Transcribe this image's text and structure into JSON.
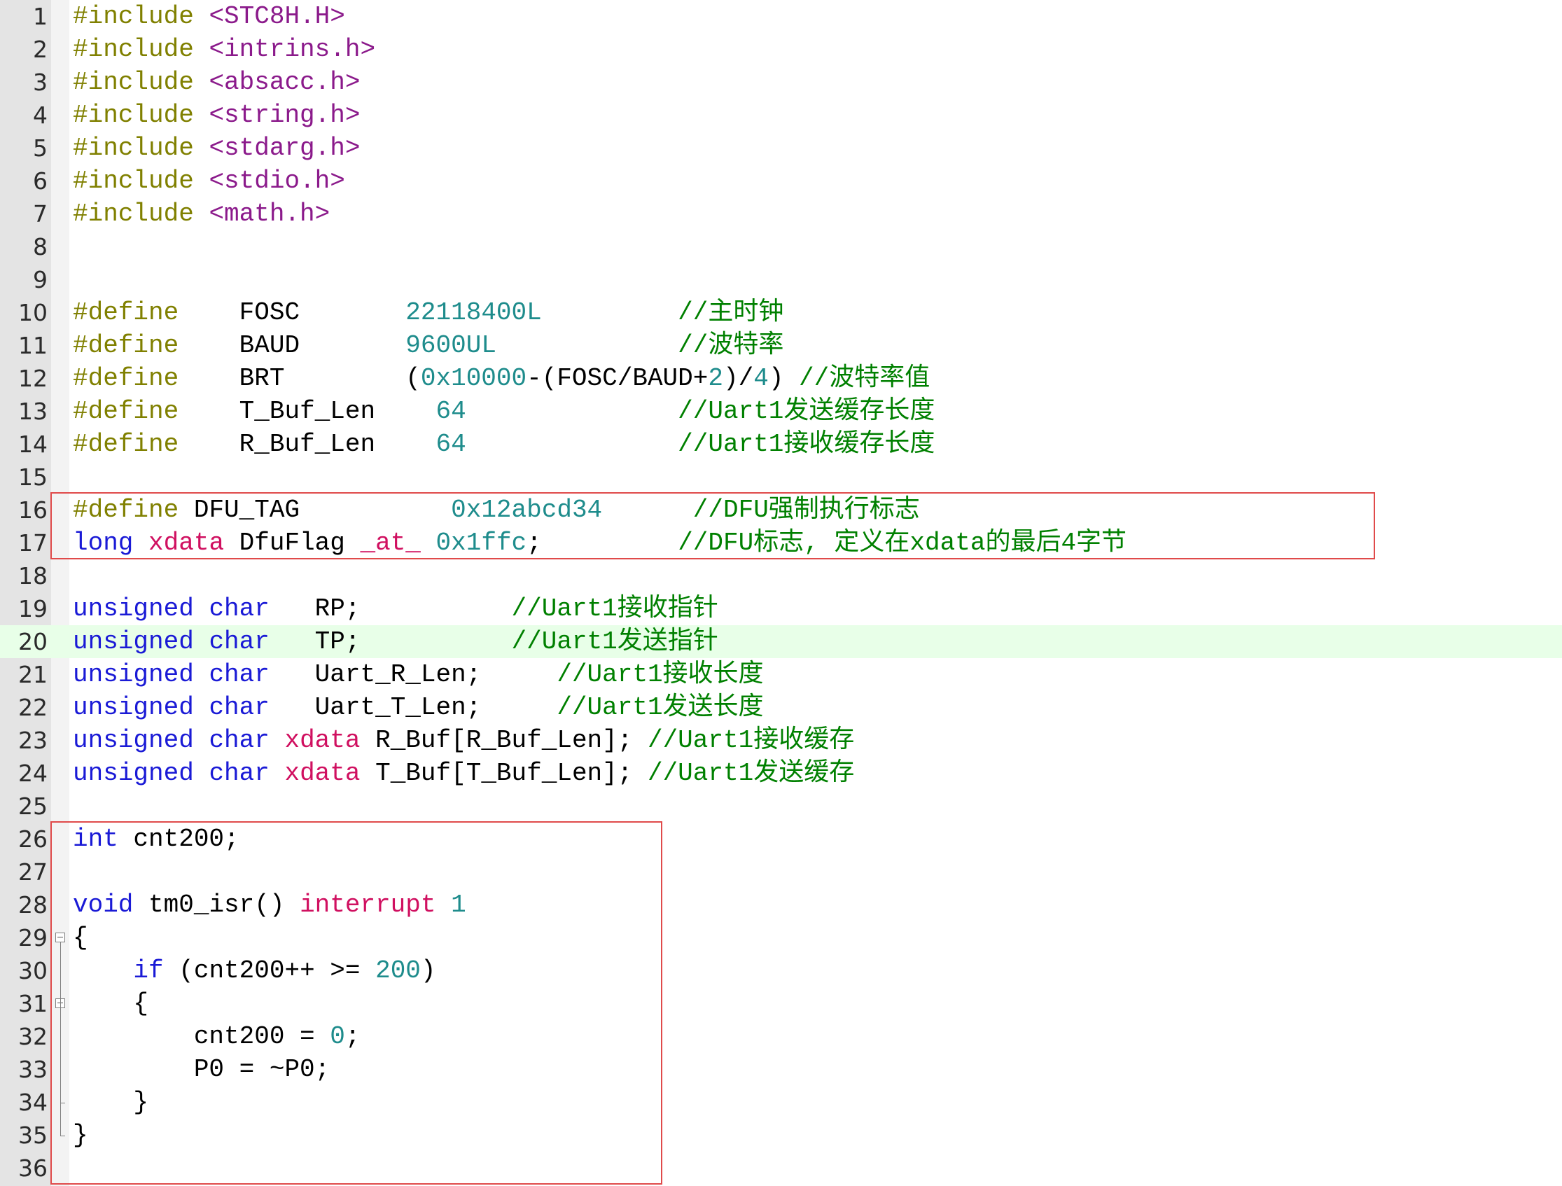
{
  "editor": {
    "current_line": 20,
    "highlight_boxes": [
      {
        "from_line": 16,
        "to_line": 17
      },
      {
        "from_line": 26,
        "to_line": 36
      }
    ],
    "lines": [
      {
        "n": "1",
        "tokens": [
          {
            "t": "#include",
            "c": "pp"
          },
          {
            "t": " ",
            "c": "plain"
          },
          {
            "t": "<STC8H.H>",
            "c": "inc"
          }
        ]
      },
      {
        "n": "2",
        "tokens": [
          {
            "t": "#include",
            "c": "pp"
          },
          {
            "t": " ",
            "c": "plain"
          },
          {
            "t": "<intrins.h>",
            "c": "inc"
          }
        ]
      },
      {
        "n": "3",
        "tokens": [
          {
            "t": "#include",
            "c": "pp"
          },
          {
            "t": " ",
            "c": "plain"
          },
          {
            "t": "<absacc.h>",
            "c": "inc"
          }
        ]
      },
      {
        "n": "4",
        "tokens": [
          {
            "t": "#include",
            "c": "pp"
          },
          {
            "t": " ",
            "c": "plain"
          },
          {
            "t": "<string.h>",
            "c": "inc"
          }
        ]
      },
      {
        "n": "5",
        "tokens": [
          {
            "t": "#include",
            "c": "pp"
          },
          {
            "t": " ",
            "c": "plain"
          },
          {
            "t": "<stdarg.h>",
            "c": "inc"
          }
        ]
      },
      {
        "n": "6",
        "tokens": [
          {
            "t": "#include",
            "c": "pp"
          },
          {
            "t": " ",
            "c": "plain"
          },
          {
            "t": "<stdio.h>",
            "c": "inc"
          }
        ]
      },
      {
        "n": "7",
        "tokens": [
          {
            "t": "#include",
            "c": "pp"
          },
          {
            "t": " ",
            "c": "plain"
          },
          {
            "t": "<math.h>",
            "c": "inc"
          }
        ]
      },
      {
        "n": "8",
        "tokens": []
      },
      {
        "n": "9",
        "tokens": []
      },
      {
        "n": "10",
        "tokens": [
          {
            "t": "#define",
            "c": "pp"
          },
          {
            "t": "    FOSC       ",
            "c": "plain"
          },
          {
            "t": "22118400L",
            "c": "num"
          },
          {
            "t": "         ",
            "c": "plain"
          },
          {
            "t": "//主时钟",
            "c": "com"
          }
        ]
      },
      {
        "n": "11",
        "tokens": [
          {
            "t": "#define",
            "c": "pp"
          },
          {
            "t": "    BAUD       ",
            "c": "plain"
          },
          {
            "t": "9600UL",
            "c": "num"
          },
          {
            "t": "            ",
            "c": "plain"
          },
          {
            "t": "//波特率",
            "c": "com"
          }
        ]
      },
      {
        "n": "12",
        "tokens": [
          {
            "t": "#define",
            "c": "pp"
          },
          {
            "t": "    BRT        (",
            "c": "plain"
          },
          {
            "t": "0x10000",
            "c": "num"
          },
          {
            "t": "-(FOSC/BAUD+",
            "c": "plain"
          },
          {
            "t": "2",
            "c": "num"
          },
          {
            "t": ")/",
            "c": "plain"
          },
          {
            "t": "4",
            "c": "num"
          },
          {
            "t": ") ",
            "c": "plain"
          },
          {
            "t": "//波特率值",
            "c": "com"
          }
        ]
      },
      {
        "n": "13",
        "tokens": [
          {
            "t": "#define",
            "c": "pp"
          },
          {
            "t": "    T_Buf_Len    ",
            "c": "plain"
          },
          {
            "t": "64",
            "c": "num"
          },
          {
            "t": "              ",
            "c": "plain"
          },
          {
            "t": "//Uart1发送缓存长度",
            "c": "com"
          }
        ]
      },
      {
        "n": "14",
        "tokens": [
          {
            "t": "#define",
            "c": "pp"
          },
          {
            "t": "    R_Buf_Len    ",
            "c": "plain"
          },
          {
            "t": "64",
            "c": "num"
          },
          {
            "t": "              ",
            "c": "plain"
          },
          {
            "t": "//Uart1接收缓存长度",
            "c": "com"
          }
        ]
      },
      {
        "n": "15",
        "tokens": []
      },
      {
        "n": "16",
        "tokens": [
          {
            "t": "#define",
            "c": "pp"
          },
          {
            "t": " DFU_TAG          ",
            "c": "plain"
          },
          {
            "t": "0x12abcd34",
            "c": "num"
          },
          {
            "t": "      ",
            "c": "plain"
          },
          {
            "t": "//DFU强制执行标志",
            "c": "com"
          }
        ]
      },
      {
        "n": "17",
        "tokens": [
          {
            "t": "long",
            "c": "kw"
          },
          {
            "t": " ",
            "c": "plain"
          },
          {
            "t": "xdata",
            "c": "kw2"
          },
          {
            "t": " DfuFlag ",
            "c": "plain"
          },
          {
            "t": "_at_",
            "c": "kw2"
          },
          {
            "t": " ",
            "c": "plain"
          },
          {
            "t": "0x1ffc",
            "c": "num"
          },
          {
            "t": ";         ",
            "c": "plain"
          },
          {
            "t": "//DFU标志, 定义在xdata的最后4字节",
            "c": "com"
          }
        ]
      },
      {
        "n": "18",
        "tokens": []
      },
      {
        "n": "19",
        "tokens": [
          {
            "t": "unsigned",
            "c": "kw"
          },
          {
            "t": " ",
            "c": "plain"
          },
          {
            "t": "char",
            "c": "kw"
          },
          {
            "t": "   RP;          ",
            "c": "plain"
          },
          {
            "t": "//Uart1接收指针",
            "c": "com"
          }
        ]
      },
      {
        "n": "20",
        "tokens": [
          {
            "t": "unsigned",
            "c": "kw"
          },
          {
            "t": " ",
            "c": "plain"
          },
          {
            "t": "char",
            "c": "kw"
          },
          {
            "t": "   TP;          ",
            "c": "plain"
          },
          {
            "t": "//Uart1发送指针",
            "c": "com"
          }
        ]
      },
      {
        "n": "21",
        "tokens": [
          {
            "t": "unsigned",
            "c": "kw"
          },
          {
            "t": " ",
            "c": "plain"
          },
          {
            "t": "char",
            "c": "kw"
          },
          {
            "t": "   Uart_R_Len;     ",
            "c": "plain"
          },
          {
            "t": "//Uart1接收长度",
            "c": "com"
          }
        ]
      },
      {
        "n": "22",
        "tokens": [
          {
            "t": "unsigned",
            "c": "kw"
          },
          {
            "t": " ",
            "c": "plain"
          },
          {
            "t": "char",
            "c": "kw"
          },
          {
            "t": "   Uart_T_Len;     ",
            "c": "plain"
          },
          {
            "t": "//Uart1发送长度",
            "c": "com"
          }
        ]
      },
      {
        "n": "23",
        "tokens": [
          {
            "t": "unsigned",
            "c": "kw"
          },
          {
            "t": " ",
            "c": "plain"
          },
          {
            "t": "char",
            "c": "kw"
          },
          {
            "t": " ",
            "c": "plain"
          },
          {
            "t": "xdata",
            "c": "kw2"
          },
          {
            "t": " R_Buf[R_Buf_Len]; ",
            "c": "plain"
          },
          {
            "t": "//Uart1接收缓存",
            "c": "com"
          }
        ]
      },
      {
        "n": "24",
        "tokens": [
          {
            "t": "unsigned",
            "c": "kw"
          },
          {
            "t": " ",
            "c": "plain"
          },
          {
            "t": "char",
            "c": "kw"
          },
          {
            "t": " ",
            "c": "plain"
          },
          {
            "t": "xdata",
            "c": "kw2"
          },
          {
            "t": " T_Buf[T_Buf_Len]; ",
            "c": "plain"
          },
          {
            "t": "//Uart1发送缓存",
            "c": "com"
          }
        ]
      },
      {
        "n": "25",
        "tokens": []
      },
      {
        "n": "26",
        "tokens": [
          {
            "t": "int",
            "c": "kw"
          },
          {
            "t": " cnt200;",
            "c": "plain"
          }
        ]
      },
      {
        "n": "27",
        "tokens": []
      },
      {
        "n": "28",
        "tokens": [
          {
            "t": "void",
            "c": "kw"
          },
          {
            "t": " tm0_isr() ",
            "c": "plain"
          },
          {
            "t": "interrupt",
            "c": "kw2"
          },
          {
            "t": " ",
            "c": "plain"
          },
          {
            "t": "1",
            "c": "num"
          }
        ]
      },
      {
        "n": "29",
        "tokens": [
          {
            "t": "{",
            "c": "plain"
          }
        ]
      },
      {
        "n": "30",
        "tokens": [
          {
            "t": "    ",
            "c": "plain"
          },
          {
            "t": "if",
            "c": "kw"
          },
          {
            "t": " (cnt200++ >= ",
            "c": "plain"
          },
          {
            "t": "200",
            "c": "num"
          },
          {
            "t": ")",
            "c": "plain"
          }
        ]
      },
      {
        "n": "31",
        "tokens": [
          {
            "t": "    {",
            "c": "plain"
          }
        ]
      },
      {
        "n": "32",
        "tokens": [
          {
            "t": "        cnt200 = ",
            "c": "plain"
          },
          {
            "t": "0",
            "c": "num"
          },
          {
            "t": ";",
            "c": "plain"
          }
        ]
      },
      {
        "n": "33",
        "tokens": [
          {
            "t": "        P0 = ~P0;",
            "c": "plain"
          }
        ]
      },
      {
        "n": "34",
        "tokens": [
          {
            "t": "    }",
            "c": "plain"
          }
        ]
      },
      {
        "n": "35",
        "tokens": [
          {
            "t": "}",
            "c": "plain"
          }
        ]
      },
      {
        "n": "36",
        "tokens": []
      }
    ],
    "fold_markers": [
      {
        "line": 29,
        "icon": "fold-minus-icon"
      },
      {
        "line": 31,
        "icon": "fold-minus-icon"
      }
    ]
  }
}
